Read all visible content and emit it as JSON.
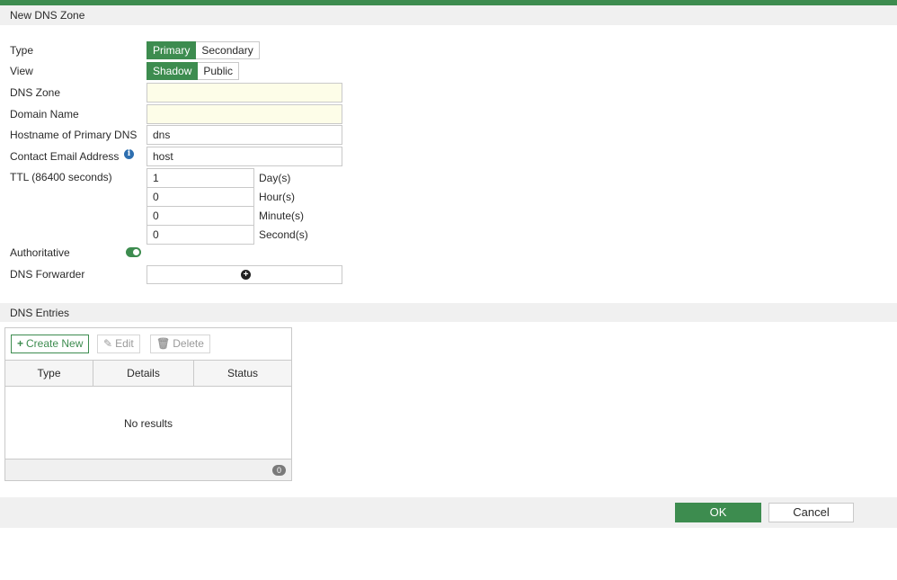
{
  "dialog": {
    "title": "New DNS Zone"
  },
  "colors": {
    "accent": "#3d8c4f",
    "required_bg": "#fdfde8",
    "info": "#2e6fb0"
  },
  "form": {
    "type": {
      "label": "Type",
      "options": [
        "Primary",
        "Secondary"
      ],
      "selected": "Primary"
    },
    "view": {
      "label": "View",
      "options": [
        "Shadow",
        "Public"
      ],
      "selected": "Shadow"
    },
    "dns_zone": {
      "label": "DNS Zone",
      "value": ""
    },
    "domain_name": {
      "label": "Domain Name",
      "value": ""
    },
    "hostname": {
      "label": "Hostname of Primary DNS",
      "value": "dns"
    },
    "contact_email": {
      "label": "Contact Email Address",
      "value": "host",
      "icon": "info-icon"
    },
    "ttl": {
      "label": "TTL (86400 seconds)",
      "days": {
        "value": "1",
        "unit": "Day(s)"
      },
      "hours": {
        "value": "0",
        "unit": "Hour(s)"
      },
      "minutes": {
        "value": "0",
        "unit": "Minute(s)"
      },
      "seconds": {
        "value": "0",
        "unit": "Second(s)"
      }
    },
    "authoritative": {
      "label": "Authoritative",
      "enabled": true
    },
    "dns_forwarder": {
      "label": "DNS Forwarder",
      "icon": "plus-circle-icon"
    }
  },
  "entries": {
    "section_title": "DNS Entries",
    "toolbar": {
      "create": "Create New",
      "edit": "Edit",
      "delete": "Delete"
    },
    "columns": [
      "Type",
      "Details",
      "Status"
    ],
    "empty_text": "No results",
    "count": "0"
  },
  "footer": {
    "ok": "OK",
    "cancel": "Cancel"
  }
}
